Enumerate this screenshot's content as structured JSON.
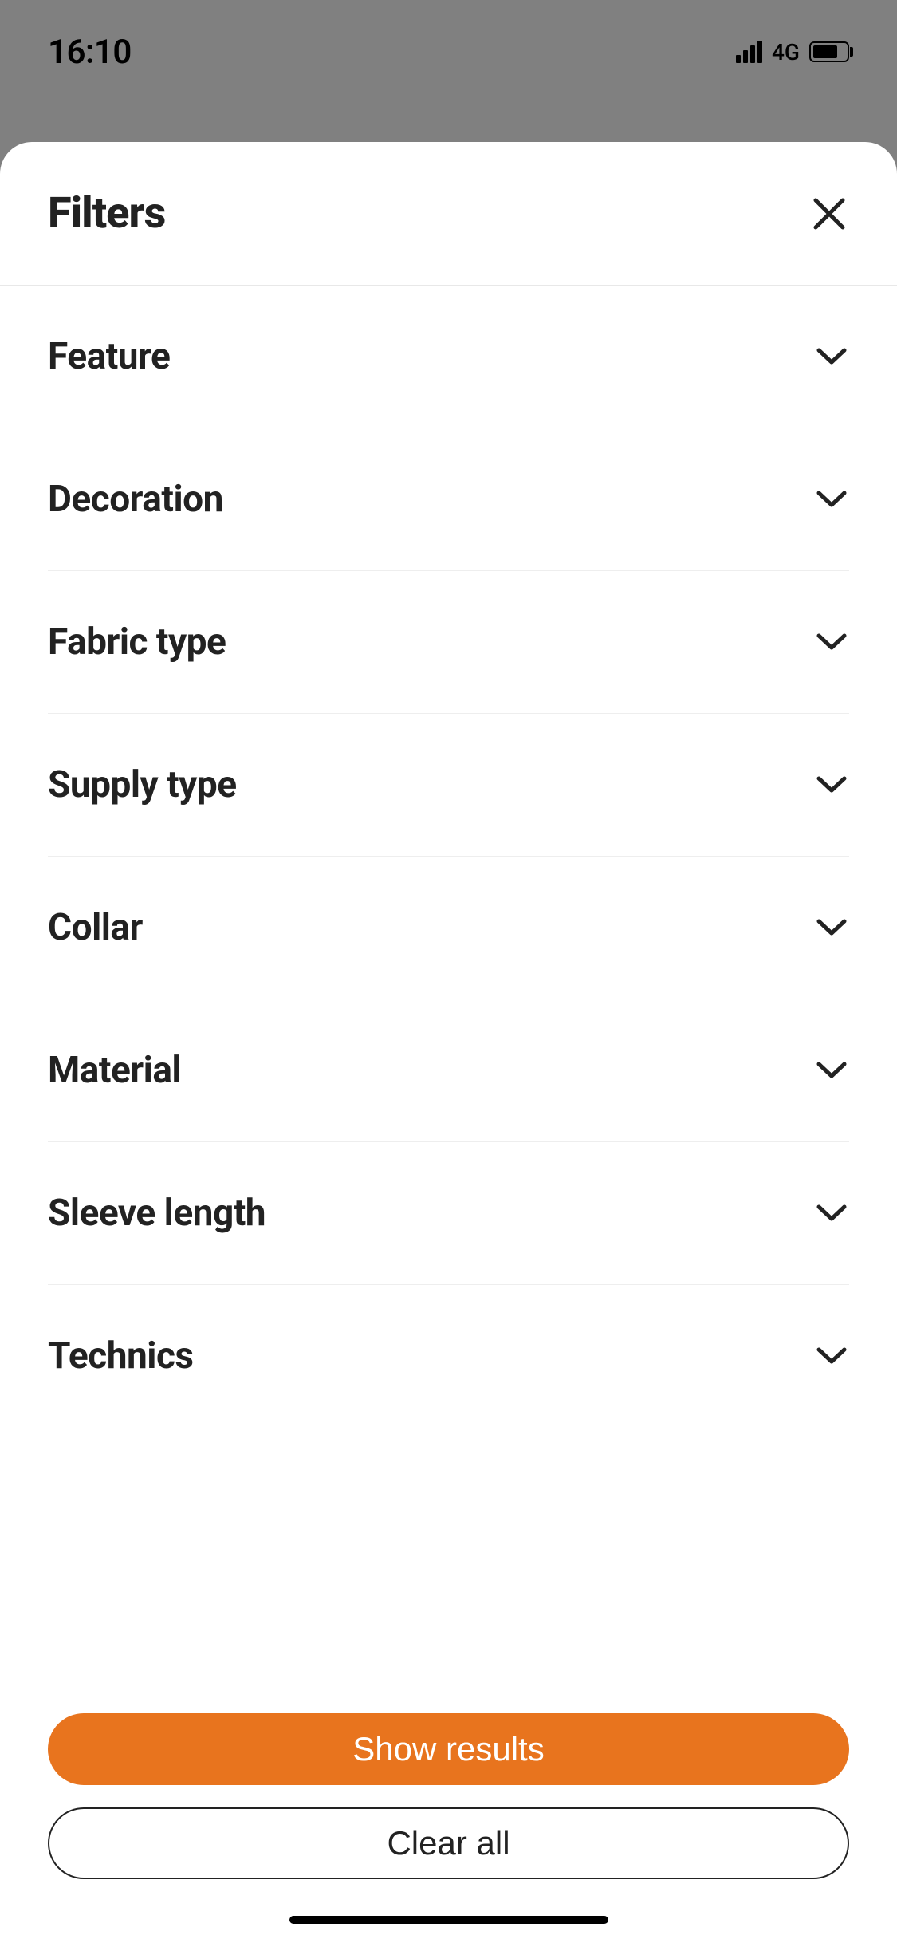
{
  "status_bar": {
    "time": "16:10",
    "network": "4G"
  },
  "sheet": {
    "title": "Filters"
  },
  "filters": [
    {
      "label": "Feature"
    },
    {
      "label": "Decoration"
    },
    {
      "label": "Fabric type"
    },
    {
      "label": "Supply type"
    },
    {
      "label": "Collar"
    },
    {
      "label": "Material"
    },
    {
      "label": "Sleeve length"
    },
    {
      "label": "Technics"
    }
  ],
  "actions": {
    "primary": "Show results",
    "secondary": "Clear all"
  }
}
